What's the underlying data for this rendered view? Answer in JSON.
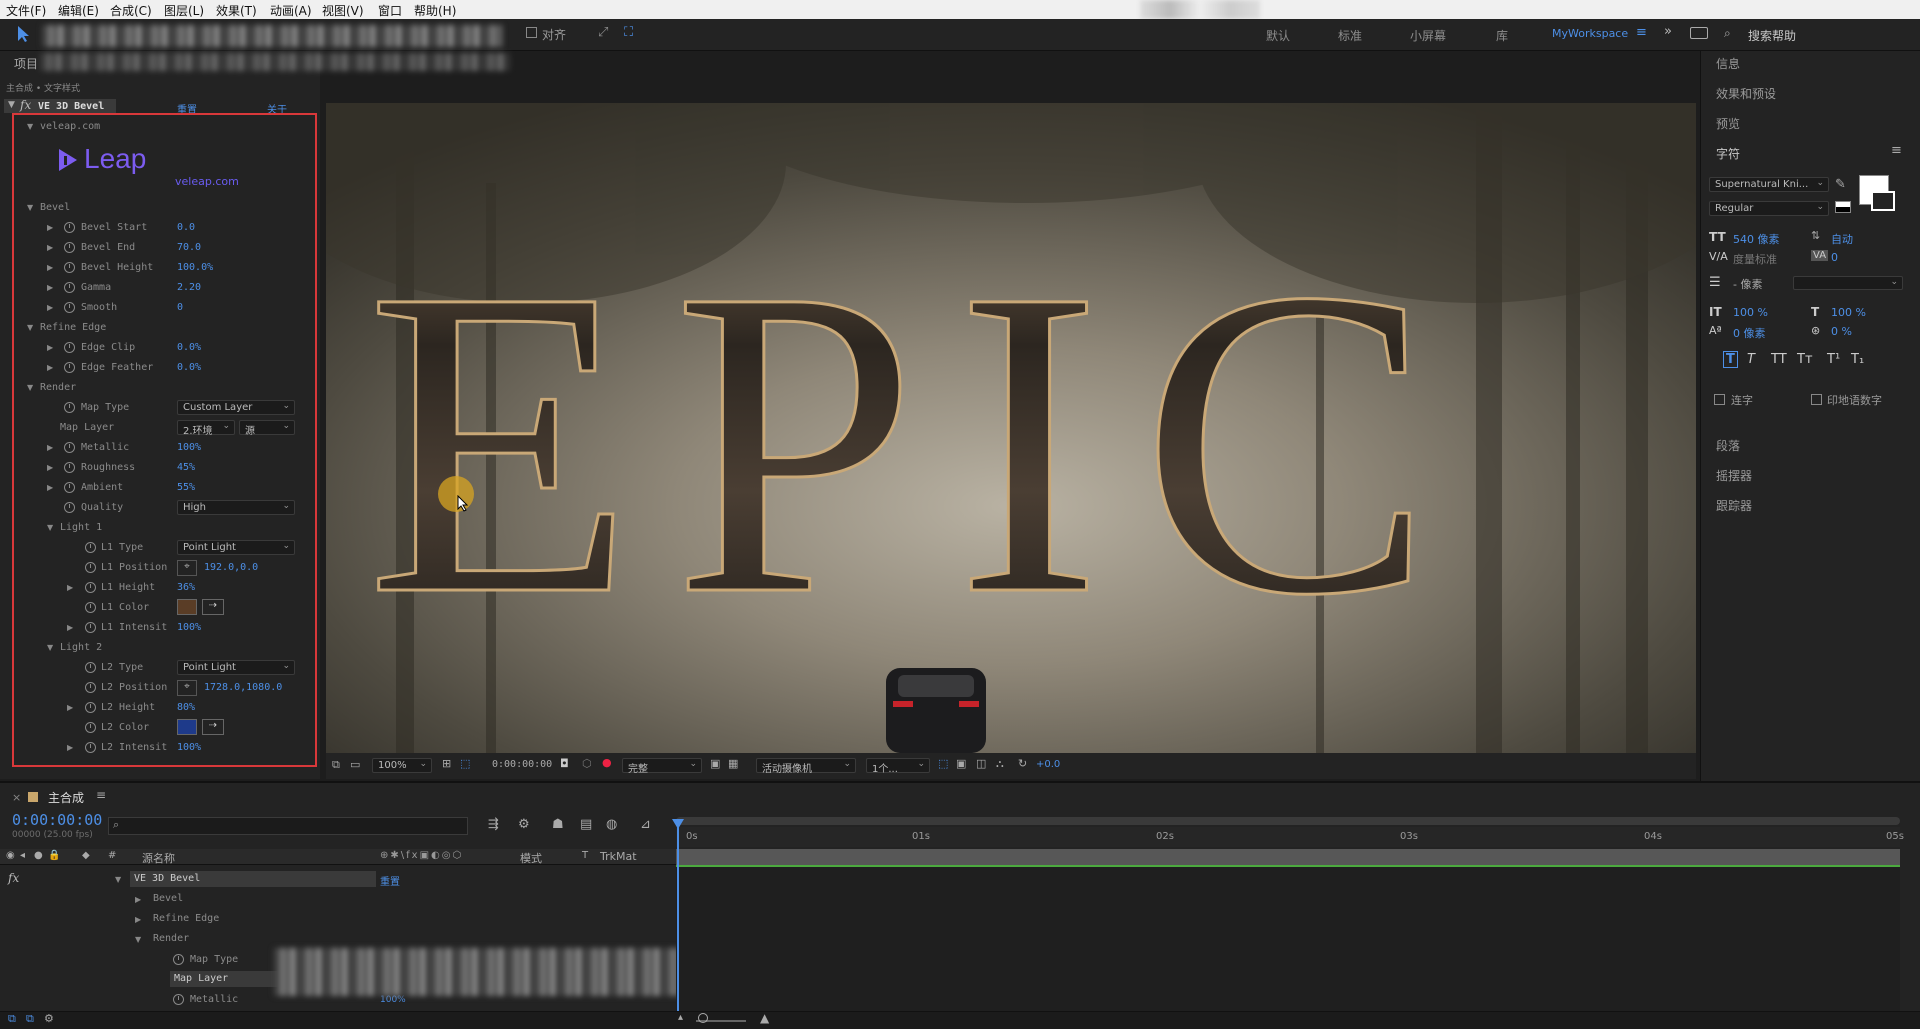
{
  "menu": [
    "文件(F)",
    "编辑(E)",
    "合成(C)",
    "图层(L)",
    "效果(T)",
    "动画(A)",
    "视图(V)",
    "窗口",
    "帮助(H)"
  ],
  "toolbar": {
    "snap_label": "对齐",
    "workspaces": [
      "默认",
      "标准",
      "小屏幕",
      "库"
    ],
    "active_workspace": "MyWorkspace",
    "search_placeholder": "搜索帮助"
  },
  "project": {
    "tab": "项目",
    "breadcrumb": "主合成 • 文字样式"
  },
  "effect": {
    "name": "VE 3D Bevel",
    "reset": "重置",
    "about": "关于",
    "site_section": "veleap.com",
    "logo_text": "Leap",
    "logo_url": "veleap.com",
    "bevel": {
      "label": "Bevel",
      "rows": [
        {
          "label": "Bevel Start",
          "value": "0.0"
        },
        {
          "label": "Bevel End",
          "value": "70.0"
        },
        {
          "label": "Bevel Height",
          "value": "100.0%"
        },
        {
          "label": "Gamma",
          "value": "2.20"
        },
        {
          "label": "Smooth",
          "value": "0"
        }
      ]
    },
    "refine": {
      "label": "Refine Edge",
      "rows": [
        {
          "label": "Edge Clip",
          "value": "0.0%"
        },
        {
          "label": "Edge Feather",
          "value": "0.0%"
        }
      ]
    },
    "render": {
      "label": "Render",
      "map_type_label": "Map Type",
      "map_type_value": "Custom Layer",
      "map_layer_label": "Map Layer",
      "map_layer_value": "2.环境",
      "map_layer_source": "源",
      "rows": [
        {
          "label": "Metallic",
          "value": "100%"
        },
        {
          "label": "Roughness",
          "value": "45%"
        },
        {
          "label": "Ambient",
          "value": "55%"
        }
      ],
      "quality_label": "Quality",
      "quality_value": "High"
    },
    "light1": {
      "label": "Light 1",
      "type_label": "L1 Type",
      "type_value": "Point Light",
      "pos_label": "L1 Position",
      "pos_value": "192.0,0.0",
      "height_label": "L1 Height",
      "height_value": "36%",
      "color_label": "L1 Color",
      "color": "#5a3d26",
      "intensity_label": "L1 Intensit",
      "intensity_value": "100%"
    },
    "light2": {
      "label": "Light 2",
      "type_label": "L2 Type",
      "type_value": "Point Light",
      "pos_label": "L2 Position",
      "pos_value": "1728.0,1080.0",
      "height_label": "L2 Height",
      "height_value": "80%",
      "color_label": "L2 Color",
      "color": "#1e3a8a",
      "intensity_label": "L2 Intensit",
      "intensity_value": "100%"
    }
  },
  "viewer": {
    "title_text": "EPIC",
    "zoom": "100%",
    "timecode": "0:00:00:00",
    "resolution": "完整",
    "camera": "活动摄像机",
    "views": "1个...",
    "exposure": "+0.0"
  },
  "right": {
    "sections": [
      "信息",
      "效果和预设",
      "预览",
      "字符"
    ],
    "font": "Supernatural Kni...",
    "style": "Regular",
    "size": "540 像素",
    "leading": "自动",
    "kerning": "度量标准",
    "tracking": "0",
    "stroke": "- 像素",
    "vscale": "100 %",
    "hscale": "100 %",
    "baseline": "0 像素",
    "tsume": "0 %",
    "ligature": "连字",
    "hindi": "印地语数字",
    "bottom_sections": [
      "段落",
      "摇摆器",
      "跟踪器"
    ],
    "type_buttons": [
      "T",
      "T",
      "TT",
      "Tт",
      "T¹",
      "T₁"
    ]
  },
  "timeline": {
    "tab": "主合成",
    "timecode": "0:00:00:00",
    "fps": "00000 (25.00 fps)",
    "col_source": "源名称",
    "col_mode": "模式",
    "col_t": "T",
    "col_trkmat": "TrkMat",
    "layer": "VE 3D Bevel",
    "reset": "重置",
    "children": [
      "Bevel",
      "Refine Edge",
      "Render"
    ],
    "render_children": [
      "Map Type",
      "Map Layer",
      "Metallic"
    ],
    "metallic_value": "100%",
    "ruler": [
      "0s",
      "01s",
      "02s",
      "03s",
      "04s",
      "05s"
    ]
  }
}
